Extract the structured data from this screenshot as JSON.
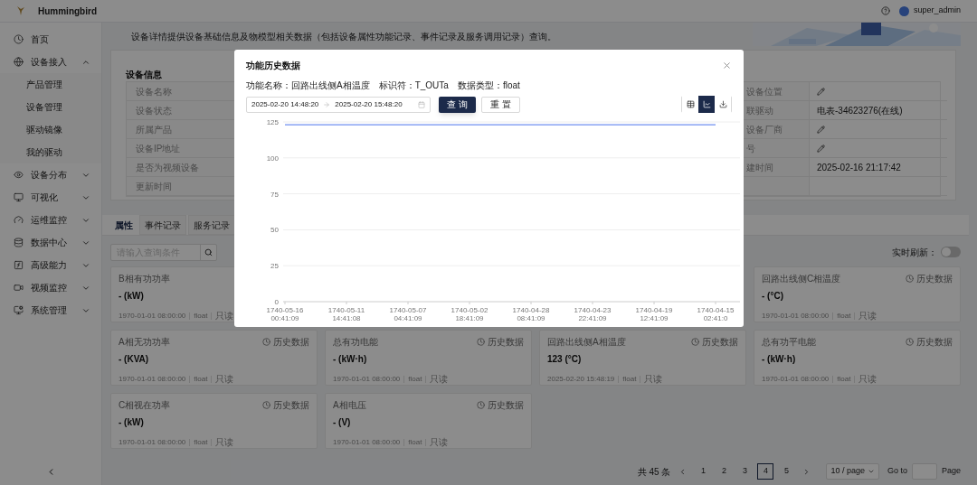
{
  "header": {
    "brand": "Hummingbird",
    "user": "super_admin"
  },
  "sidebar": {
    "items": [
      {
        "label": "首页",
        "kind": "link"
      },
      {
        "label": "设备接入",
        "kind": "group",
        "expanded": true,
        "children": [
          {
            "label": "产品管理"
          },
          {
            "label": "设备管理"
          },
          {
            "label": "驱动镜像"
          },
          {
            "label": "我的驱动"
          }
        ]
      },
      {
        "label": "设备分布",
        "kind": "group",
        "expanded": false
      },
      {
        "label": "可视化",
        "kind": "group",
        "expanded": false
      },
      {
        "label": "运维监控",
        "kind": "group",
        "expanded": false
      },
      {
        "label": "数据中心",
        "kind": "group",
        "expanded": false
      },
      {
        "label": "高级能力",
        "kind": "group",
        "expanded": false
      },
      {
        "label": "视频监控",
        "kind": "group",
        "expanded": false
      },
      {
        "label": "系统管理",
        "kind": "group",
        "expanded": false
      }
    ]
  },
  "intro": "设备详情提供设备基础信息及物模型相关数据（包括设备属性功能记录、事件记录及服务调用记录）查询。",
  "device_info": {
    "title": "设备信息",
    "left_labels": [
      "设备名称",
      "设备状态",
      "所属产品",
      "设备IP地址",
      "是否为视频设备",
      "更新时间"
    ],
    "right_rows": [
      {
        "label": "设备位置",
        "kind": "edit"
      },
      {
        "label": "联驱动",
        "kind": "text",
        "value": "电表-34623276(在线)"
      },
      {
        "label": "设备厂商",
        "kind": "edit"
      },
      {
        "label": "号",
        "kind": "edit"
      },
      {
        "label": "建时间",
        "kind": "text",
        "value": "2025-02-16 21:17:42"
      }
    ]
  },
  "tabs": [
    {
      "label": "属性",
      "selected": true
    },
    {
      "label": "事件记录",
      "selected": false
    },
    {
      "label": "服务记录",
      "selected": false
    }
  ],
  "search": {
    "placeholder": "请输入查询条件"
  },
  "realtime": {
    "label": "实时刷新：",
    "on": false
  },
  "card_rows": [
    [
      {
        "name": "B相有功功率",
        "value": "- (kW)",
        "time": "1970-01-01 08:00:00",
        "type": "float",
        "access": "只读"
      },
      null,
      null,
      {
        "name": "回路出线侧C相温度",
        "history": "历史数据",
        "value": "- (°C)",
        "time": "1970-01-01 08:00:00",
        "type": "float",
        "access": "只读"
      }
    ],
    [
      {
        "name": "A相无功功率",
        "history": "历史数据",
        "value": "- (KVA)",
        "time": "1970-01-01 08:00:00",
        "type": "float",
        "access": "只读"
      },
      {
        "name": "总有功电能",
        "history": "历史数据",
        "value": "- (kW·h)",
        "time": "1970-01-01 08:00:00",
        "type": "float",
        "access": "只读"
      },
      {
        "name": "回路出线侧A相温度",
        "history": "历史数据",
        "value": "123 (°C)",
        "time": "2025-02-20 15:48:19",
        "type": "float",
        "access": "只读"
      },
      {
        "name": "总有功平电能",
        "history": "历史数据",
        "value": "- (kW·h)",
        "time": "1970-01-01 08:00:00",
        "type": "float",
        "access": "只读"
      }
    ],
    [
      {
        "name": "C相视在功率",
        "history": "历史数据",
        "value": "- (kW)",
        "time": "1970-01-01 08:00:00",
        "type": "float",
        "access": "只读"
      },
      {
        "name": "A相电压",
        "history": "历史数据",
        "value": "- (V)",
        "time": "1970-01-01 08:00:00",
        "type": "float",
        "access": "只读"
      }
    ]
  ],
  "pagination": {
    "total": "共 45 条",
    "pages": [
      {
        "label": "1",
        "selected": false
      },
      {
        "label": "2",
        "selected": false
      },
      {
        "label": "3",
        "selected": false
      },
      {
        "label": "4",
        "selected": true
      },
      {
        "label": "5",
        "selected": false
      }
    ],
    "page_size": "10 / page",
    "goto": "Go to",
    "page_suffix": "Page"
  },
  "modal": {
    "title": "功能历史数据",
    "info": [
      {
        "label": "功能名称：",
        "value": "回路出线侧A相温度"
      },
      {
        "label": "标识符：",
        "value": "T_OUTa"
      },
      {
        "label": "数据类型：",
        "value": "float"
      }
    ],
    "range": {
      "start": "2025-02-20 14:48:20",
      "end": "2025-02-20 15:48:20"
    },
    "buttons": [
      {
        "label": "查 询",
        "kind": "primary"
      },
      {
        "label": "重 置",
        "kind": "default"
      }
    ],
    "views": [
      {
        "kind": "table",
        "selected": false
      },
      {
        "kind": "chart",
        "selected": true
      },
      {
        "kind": "download",
        "selected": false
      }
    ],
    "chart_data": {
      "type": "line",
      "categories": [
        "1740-05-16 00:41:09",
        "1740-05-11 14:41:08",
        "1740-05-07 04:41:09",
        "1740-05-02 18:41:09",
        "1740-04-28 08:41:09",
        "1740-04-23 22:41:09",
        "1740-04-19 12:41:09",
        "1740-04-15 02:41:0"
      ],
      "series": [
        {
          "color": "#6f8ff0",
          "values": [
            123,
            123,
            123,
            123,
            123,
            123,
            123,
            123
          ]
        }
      ],
      "grid": true,
      "ylim": [
        0,
        125
      ],
      "yticks": [
        0,
        25,
        50,
        75,
        100,
        125
      ]
    }
  }
}
